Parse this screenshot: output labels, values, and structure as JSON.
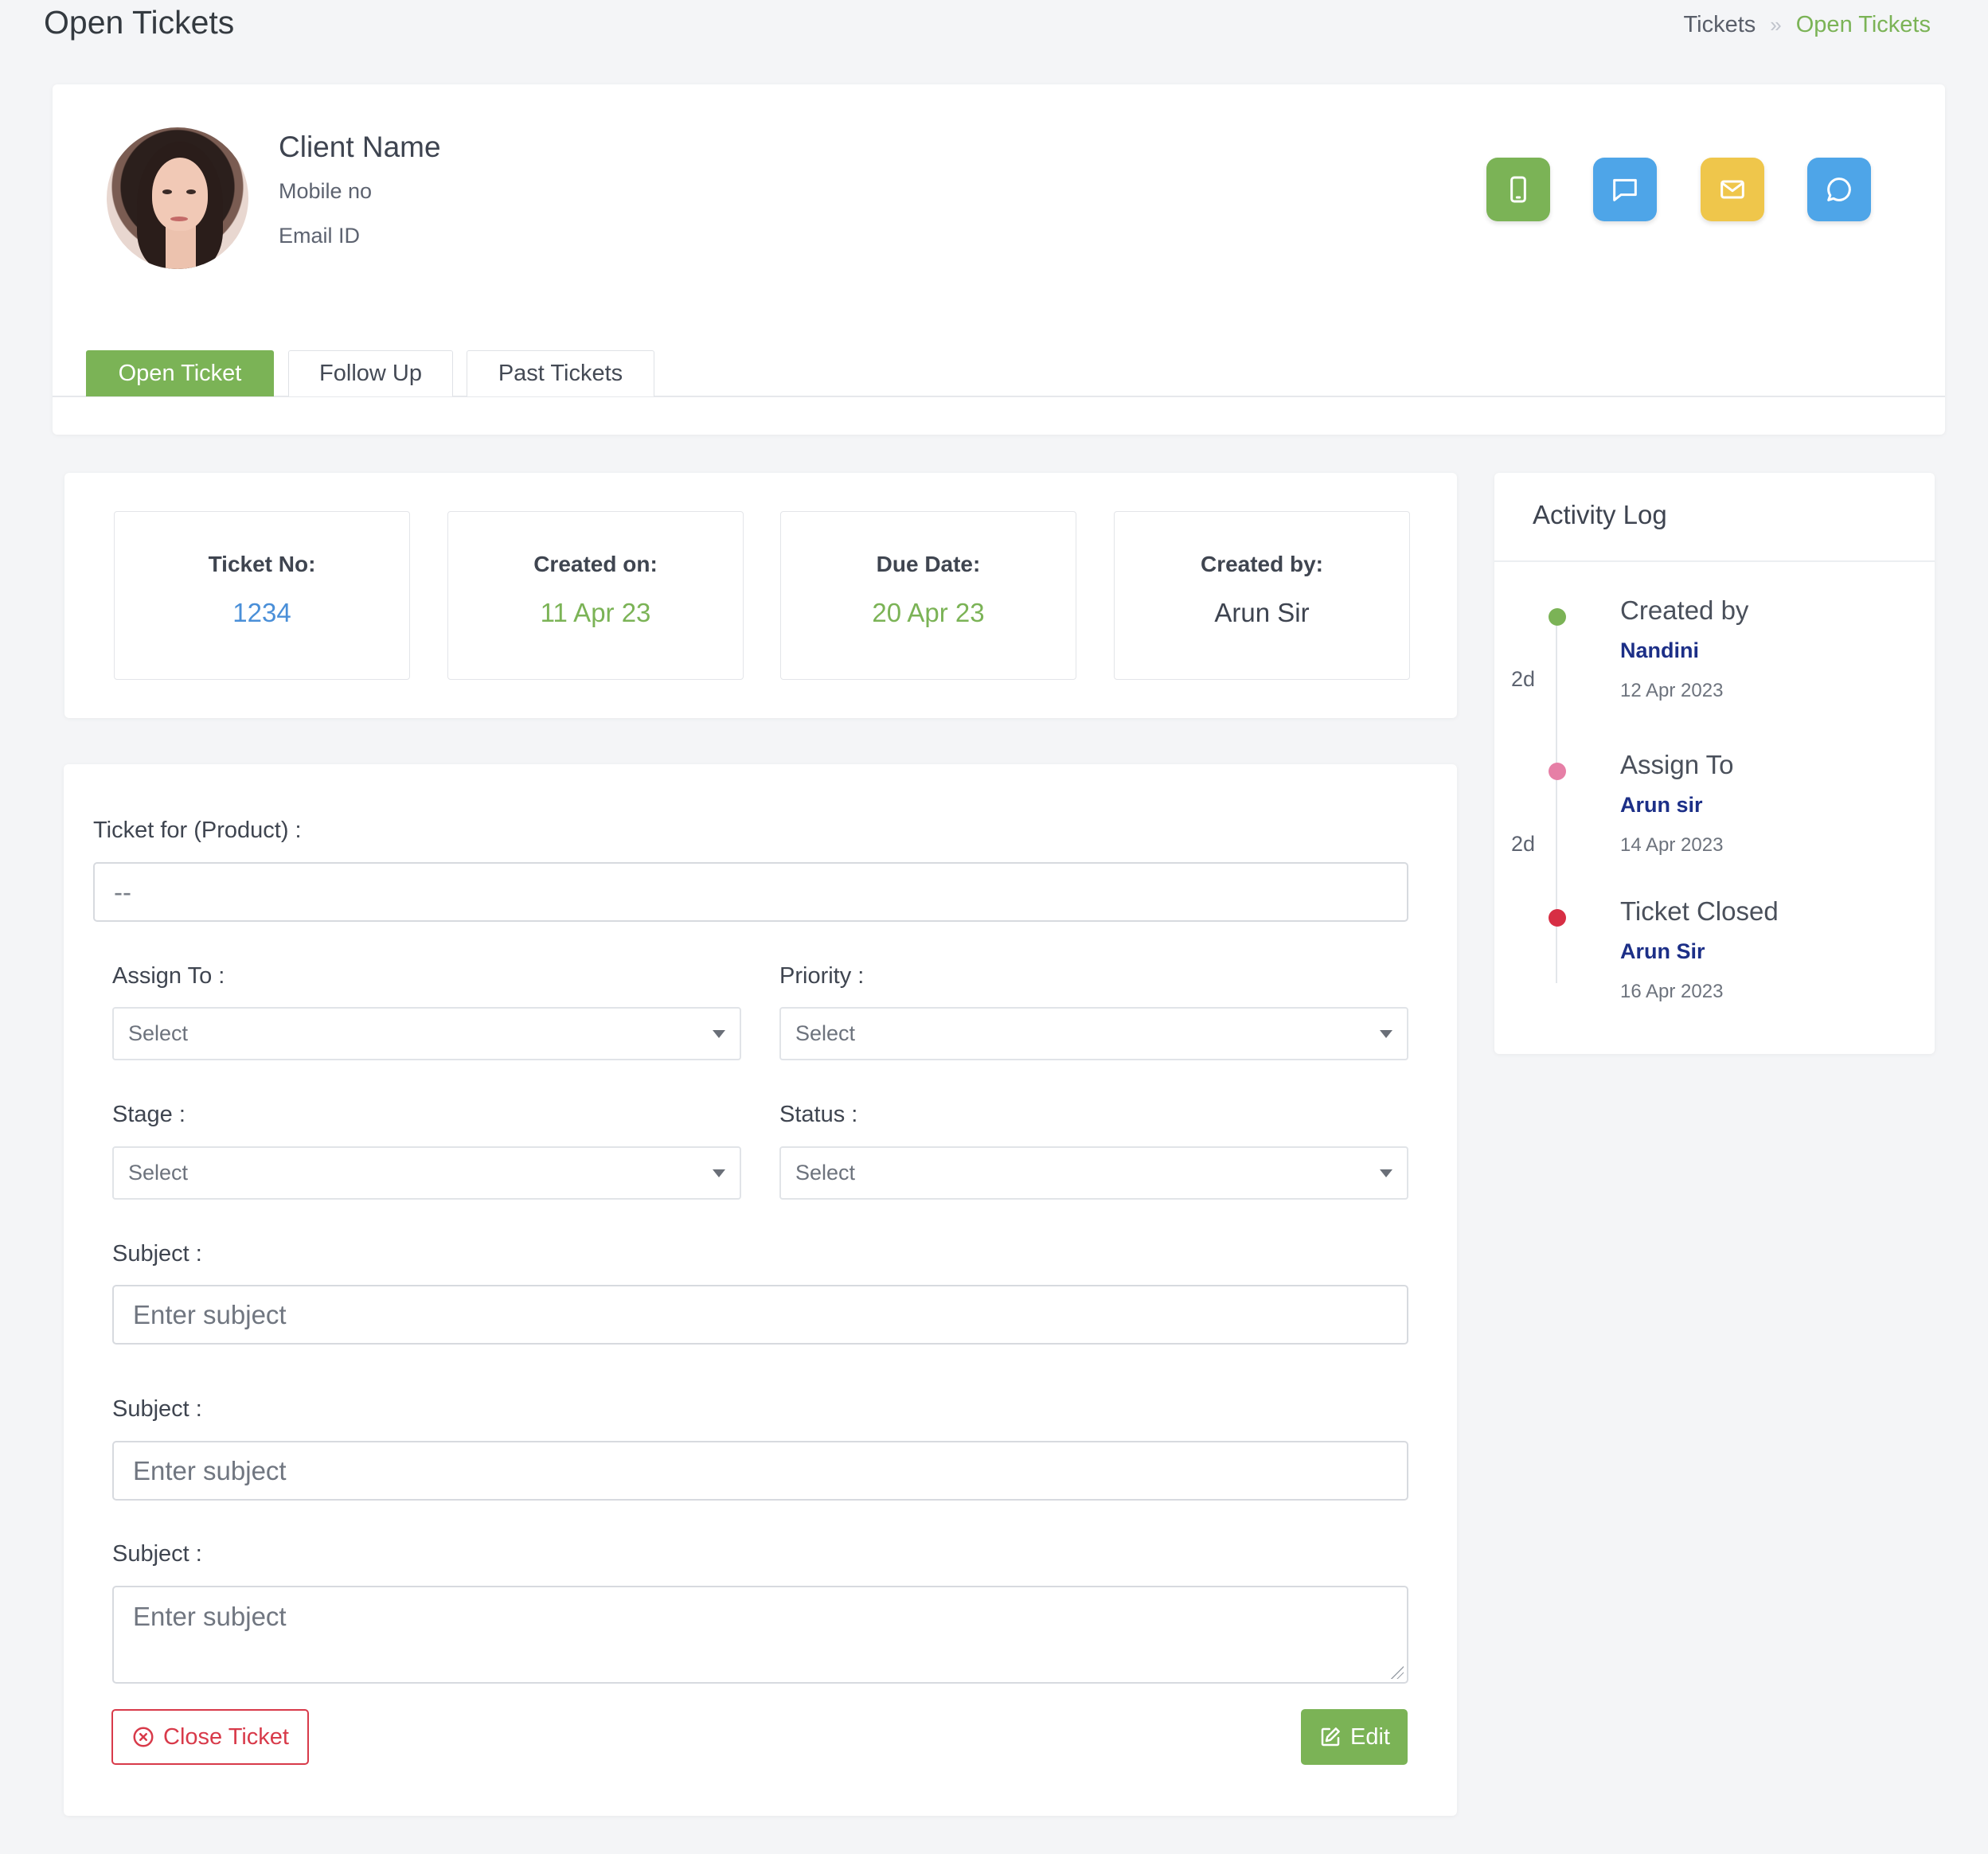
{
  "header": {
    "title": "Open Tickets",
    "breadcrumb": [
      "Tickets",
      "Open Tickets"
    ]
  },
  "client": {
    "name": "Client Name",
    "mobile": "Mobile no",
    "email": "Email ID",
    "actions": [
      {
        "icon": "phone-icon",
        "color": "#7bb356"
      },
      {
        "icon": "sms-icon",
        "color": "#4ea5e8"
      },
      {
        "icon": "mail-icon",
        "color": "#efc64b"
      },
      {
        "icon": "chat-icon",
        "color": "#4ea5e8"
      }
    ]
  },
  "tabs": [
    {
      "label": "Open Ticket",
      "active": true
    },
    {
      "label": "Follow Up",
      "active": false
    },
    {
      "label": "Past Tickets",
      "active": false
    }
  ],
  "ticket_info": [
    {
      "label": "Ticket No:",
      "value": "1234",
      "color": "#4a8fd8"
    },
    {
      "label": "Created on:",
      "value": "11 Apr 23",
      "color": "#7bb356"
    },
    {
      "label": "Due Date:",
      "value": "20 Apr 23",
      "color": "#7bb356"
    },
    {
      "label": "Created by:",
      "value": "Arun Sir",
      "color": "#3e4450"
    }
  ],
  "form": {
    "product_label": "Ticket for (Product) :",
    "product_value": "--",
    "assign_label": "Assign To :",
    "assign_value": "Select",
    "priority_label": "Priority :",
    "priority_value": "Select",
    "stage_label": "Stage :",
    "stage_value": "Select",
    "status_label": "Status :",
    "status_value": "Select",
    "subject1_label": "Subject :",
    "subject1_placeholder": "Enter subject",
    "subject2_label": "Subject :",
    "subject2_placeholder": "Enter subject",
    "subject3_label": "Subject :",
    "subject3_placeholder": "Enter subject",
    "close_label": "Close Ticket",
    "edit_label": "Edit"
  },
  "activity_log": {
    "title": "Activity Log",
    "entries": [
      {
        "title": "Created by",
        "who": "Nandini",
        "date": "12 Apr 2023",
        "color": "#7bb356"
      },
      {
        "title": "Assign To",
        "who": "Arun sir",
        "date": "14 Apr 2023",
        "color": "#e67fa6"
      },
      {
        "title": "Ticket Closed",
        "who": "Arun Sir",
        "date": "16 Apr 2023",
        "color": "#d72e44"
      }
    ],
    "gaps": [
      "2d",
      "2d"
    ]
  },
  "colors": {
    "accent": "#7bb356",
    "danger": "#d83a4a",
    "link": "#1c2f87"
  }
}
